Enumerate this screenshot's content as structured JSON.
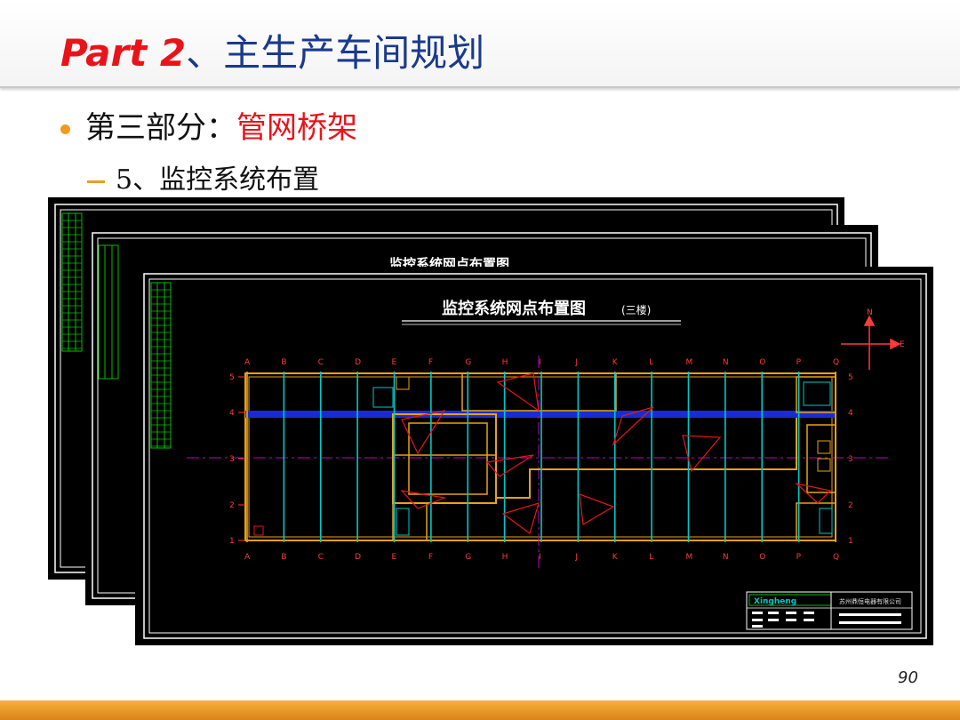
{
  "slide": {
    "title_part": "Part 2",
    "title_rest": "、主生产车间规划",
    "bullet1_prefix": "第三部分：",
    "bullet1_highlight": "管网桥架",
    "bullet2_dash": "–",
    "bullet2_text": "5、监控系统布置",
    "page_number": "90"
  },
  "drawing": {
    "title": "监控系统网点布置图",
    "title_suffix": "(三楼)",
    "back_title": "监控系统网点布置图",
    "axis_letters": [
      "A",
      "B",
      "C",
      "D",
      "E",
      "F",
      "G",
      "H",
      "I",
      "J",
      "K",
      "L",
      "M",
      "N",
      "O",
      "P",
      "Q"
    ],
    "axis_numbers": [
      "5",
      "4",
      "3",
      "2",
      "1"
    ],
    "compass_n": "N",
    "compass_e": "E",
    "title_block_company": "苏州鼎恒电器有限公司",
    "title_block_brand": "Xingheng",
    "colors": {
      "background": "#000000",
      "frame": "#ffffff",
      "wall": "#e8a317",
      "column": "#00c8c8",
      "corridor": "#1a2bd6",
      "camera": "#e8141a",
      "axis": "#ff3a3a",
      "grid_green": "#00c000",
      "centerline": "#c000c0"
    }
  },
  "ui": {
    "accent_orange": "#f39a1e",
    "title_red": "#e8141a",
    "title_blue": "#1b3a8c"
  }
}
